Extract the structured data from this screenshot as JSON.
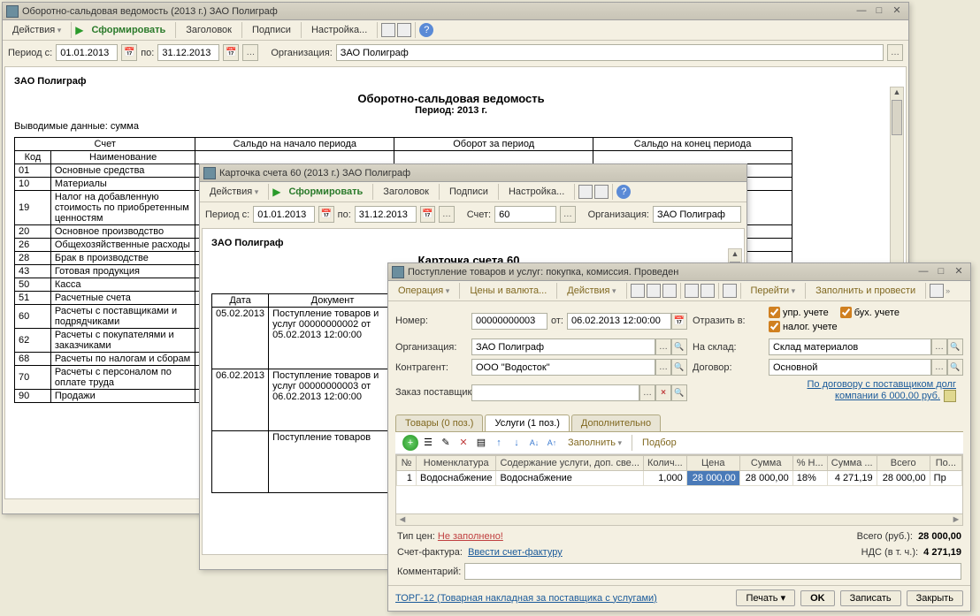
{
  "w1": {
    "title": "Оборотно-сальдовая ведомость (2013 г.) ЗАО Полиграф",
    "toolbar": {
      "actions": "Действия",
      "form": "Сформировать",
      "header": "Заголовок",
      "signs": "Подписи",
      "settings": "Настройка..."
    },
    "filter": {
      "period_from": "Период с:",
      "from": "01.01.2013",
      "to_lbl": "по:",
      "to": "31.12.2013",
      "org_lbl": "Организация:",
      "org": "ЗАО Полиграф"
    },
    "report": {
      "org": "ЗАО Полиграф",
      "title": "Оборотно-сальдовая ведомость",
      "period": "Период: 2013 г.",
      "note": "Выводимые данные: сумма",
      "h_account": "Счет",
      "h_code": "Код",
      "h_name": "Наименование",
      "h_start": "Сальдо на начало периода",
      "h_turn": "Оборот за период",
      "h_end": "Сальдо на конец периода",
      "rows": [
        {
          "code": "01",
          "name": "Основные средства"
        },
        {
          "code": "10",
          "name": "Материалы"
        },
        {
          "code": "19",
          "name": "Налог на добавленную стоимость по приобретенным ценностям"
        },
        {
          "code": "20",
          "name": "Основное производство"
        },
        {
          "code": "26",
          "name": "Общехозяйственные расходы"
        },
        {
          "code": "28",
          "name": "Брак в производстве"
        },
        {
          "code": "43",
          "name": "Готовая продукция"
        },
        {
          "code": "50",
          "name": "Касса"
        },
        {
          "code": "51",
          "name": "Расчетные счета"
        },
        {
          "code": "60",
          "name": "Расчеты с поставщиками и подрядчиками"
        },
        {
          "code": "62",
          "name": "Расчеты с покупателями и заказчиками"
        },
        {
          "code": "68",
          "name": "Расчеты по налогам и сборам"
        },
        {
          "code": "70",
          "name": "Расчеты с персоналом по оплате труда"
        },
        {
          "code": "90",
          "name": "Продажи"
        }
      ]
    }
  },
  "w2": {
    "title": "Карточка счета 60 (2013 г.) ЗАО Полиграф",
    "toolbar": {
      "actions": "Действия",
      "form": "Сформировать",
      "header": "Заголовок",
      "signs": "Подписи",
      "settings": "Настройка..."
    },
    "filter": {
      "period_from": "Период с:",
      "from": "01.01.2013",
      "to_lbl": "по:",
      "to": "31.12.2013",
      "acc_lbl": "Счет:",
      "acc": "60",
      "org_lbl": "Организация:",
      "org": "ЗАО Полиграф"
    },
    "report": {
      "org": "ЗАО Полиграф",
      "title": "Карточка счета 60",
      "h_date": "Дата",
      "h_doc": "Документ",
      "rows": [
        {
          "date": "05.02.2013",
          "doc": "Поступление товаров и услуг 00000000002 от 05.02.2013 12:00:00"
        },
        {
          "date": "06.02.2013",
          "doc": "Поступление товаров и услуг 00000000003 от 06.02.2013 12:00:00"
        },
        {
          "date": "",
          "doc": "Поступление товаров"
        }
      ]
    }
  },
  "w3": {
    "title": "Поступление товаров и услуг: покупка, комиссия. Проведен",
    "toolbar": {
      "operation": "Операция",
      "prices": "Цены и валюта...",
      "actions": "Действия",
      "goto": "Перейти",
      "fillpost": "Заполнить и провести"
    },
    "form": {
      "num_lbl": "Номер:",
      "num": "00000000003",
      "from_lbl": "от:",
      "date": "06.02.2013 12:00:00",
      "reflect_lbl": "Отразить в:",
      "chk_upr": "упр. учете",
      "chk_buh": "бух. учете",
      "chk_nal": "налог. учете",
      "org_lbl": "Организация:",
      "org": "ЗАО Полиграф",
      "wh_lbl": "На склад:",
      "wh": "Склад материалов",
      "ka_lbl": "Контрагент:",
      "ka": "ООО \"Водосток\"",
      "dog_lbl": "Договор:",
      "dog": "Основной",
      "order_lbl": "Заказ поставщику:",
      "debt": "По договору с поставщиком долг компании 6 000,00 руб."
    },
    "tabs": {
      "t1": "Товары (0 поз.)",
      "t2": "Услуги (1 поз.)",
      "t3": "Дополнительно"
    },
    "gridbar": {
      "fill": "Заполнить",
      "pick": "Подбор"
    },
    "grid": {
      "h_n": "№",
      "h_nom": "Номенклатура",
      "h_cont": "Содержание услуги, доп. све...",
      "h_qty": "Колич...",
      "h_price": "Цена",
      "h_sum": "Сумма",
      "h_nds": "% Н...",
      "h_ndssum": "Сумма ...",
      "h_total": "Всего",
      "h_po": "По...",
      "rows": [
        {
          "n": "1",
          "nom": "Водоснабжение",
          "cont": "Водоснабжение",
          "qty": "1,000",
          "price": "28 000,00",
          "sum": "28 000,00",
          "nds": "18%",
          "ndssum": "4 271,19",
          "total": "28 000,00",
          "po": "Пр"
        }
      ]
    },
    "totals": {
      "type_lbl": "Тип цен:",
      "type_val": "Не заполнено!",
      "total_lbl": "Всего (руб.):",
      "total": "28 000,00",
      "sf_lbl": "Счет-фактура:",
      "sf_val": "Ввести счет-фактуру",
      "nds_lbl": "НДС (в т. ч.):",
      "nds": "4 271,19",
      "comment_lbl": "Комментарий:"
    },
    "footer": {
      "torg": "ТОРГ-12 (Товарная накладная за поставщика с услугами)",
      "print": "Печать",
      "ok": "OK",
      "save": "Записать",
      "close": "Закрыть"
    }
  }
}
